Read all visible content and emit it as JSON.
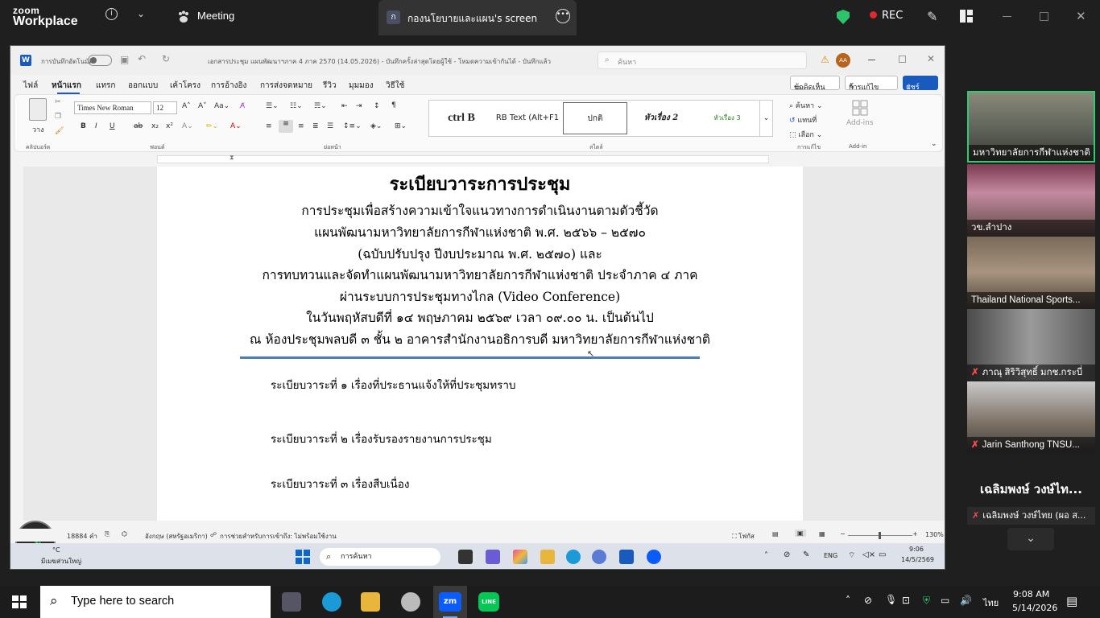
{
  "zoom": {
    "brand_top": "zoom",
    "brand_bottom": "Workplace",
    "meeting_label": "Meeting",
    "share_tab_initial": "ก",
    "share_tab_title": "กองนโยบายและแผน's screen",
    "rec_label": "REC"
  },
  "word": {
    "title_bar": {
      "autosave": "การบันทึกอัตโนมัติ",
      "doc_title": "เอกสารประชุม แผนพัฒนาฯภาค 4 ภาค 2570 (14.05.2026) - บันทึกครั้งล่าสุดโดยผู้ใช้ - โหมดความเข้ากันได้ - บันทึกแล้ว",
      "search_placeholder": "ค้นหา",
      "avatar": "AA"
    },
    "tabs": [
      "ไฟล์",
      "หน้าแรก",
      "แทรก",
      "ออกแบบ",
      "เค้าโครง",
      "การอ้างอิง",
      "การส่งจดหมาย",
      "รีวิว",
      "มุมมอง",
      "วิธีใช้"
    ],
    "ribbon_buttons": {
      "comments": "ข้อคิดเห็น",
      "editing": "การแก้ไข",
      "share": "แชร์"
    },
    "font_name": "Times New Roman",
    "font_size": "12",
    "paste": "วาง",
    "styles": [
      "ctrl B",
      "RB Text (Alt+F1",
      "ปกติ",
      "หัวเรื่อง 2",
      "หัวเรื่อง 3"
    ],
    "edit_group": {
      "find": "ค้นหา",
      "replace": "แทนที่",
      "select": "เลือก"
    },
    "addins": "Add-ins",
    "group_labels": [
      "คลิปบอร์ด",
      "ฟอนต์",
      "ย่อหน้า",
      "สไตล์",
      "การแก้ไข",
      "Add-in"
    ],
    "document": {
      "title": "ระเบียบวาระการประชุม",
      "lines": [
        "การประชุมเพื่อสร้างความเข้าใจแนวทางการดำเนินงานตามตัวชี้วัด",
        "แผนพัฒนามหาวิทยาลัยการกีฬาแห่งชาติ พ.ศ. ๒๕๖๖ – ๒๕๗๐",
        "(ฉบับปรับปรุง ปีงบประมาณ พ.ศ. ๒๕๗๐) และ",
        "การทบทวนและจัดทำแผนพัฒนามหาวิทยาลัยการกีฬาแห่งชาติ ประจำภาค ๔ ภาค",
        "ผ่านระบบการประชุมทางไกล (Video Conference)",
        "ในวันพฤหัสบดีที่ ๑๔ พฤษภาคม ๒๕๖๙ เวลา ๐๙.๐๐ น. เป็นต้นไป",
        "ณ ห้องประชุมพลบดี ๓ ชั้น ๒ อาคารสำนักงานอธิการบดี มหาวิทยาลัยการกีฬาแห่งชาติ"
      ],
      "agenda": [
        "ระเบียบวาระที่ ๑  เรื่องที่ประธานแจ้งให้ที่ประชุมทราบ",
        "ระเบียบวาระที่ ๒  เรื่องรับรองรายงานการประชุม",
        "ระเบียบวาระที่ ๓  เรื่องสืบเนื่อง"
      ]
    },
    "status": {
      "words": "18884 คำ",
      "language": "อังกฤษ (สหรัฐอเมริกา)",
      "accessibility": "การช่วยสำหรับการเข้าถึง: ไม่พร้อมใช้งาน",
      "focus": "โฟกัส",
      "zoom": "130%"
    },
    "inner_taskbar": {
      "weather_temp": "°C",
      "weather": "มีเมฆส่วนใหญ่",
      "search": "การค้นหา",
      "lang": "ENG",
      "time": "9:06",
      "date": "14/5/2569"
    }
  },
  "participants": [
    {
      "name": "มหาวิทยาลัยการกีฬาแห่งชาติ",
      "muted": false
    },
    {
      "name": "วข.ลำปาง",
      "muted": false
    },
    {
      "name": "Thailand National Sports...",
      "muted": false
    },
    {
      "name": "ภาณุ  สิริวิสุทธิ์ มกช.กระบี่",
      "muted": true
    },
    {
      "name": "Jarin Santhong TNSU...",
      "muted": true
    }
  ],
  "speaker": {
    "display_name": "เฉลิมพงษ์ วงษ์ไท...",
    "label": "เฉลิมพงษ์ วงษ์ไทย (ผอ ส..."
  },
  "taskbar": {
    "search_placeholder": "Type here to search",
    "lang": "ไทย",
    "time": "9:08 AM",
    "date": "5/14/2026"
  },
  "colors": {
    "zoom_bg": "#1f1f1f",
    "word_accent": "#185abd",
    "active_speaker": "#2ecc71",
    "shield": "#2cc36b",
    "rec": "#e0292b"
  }
}
